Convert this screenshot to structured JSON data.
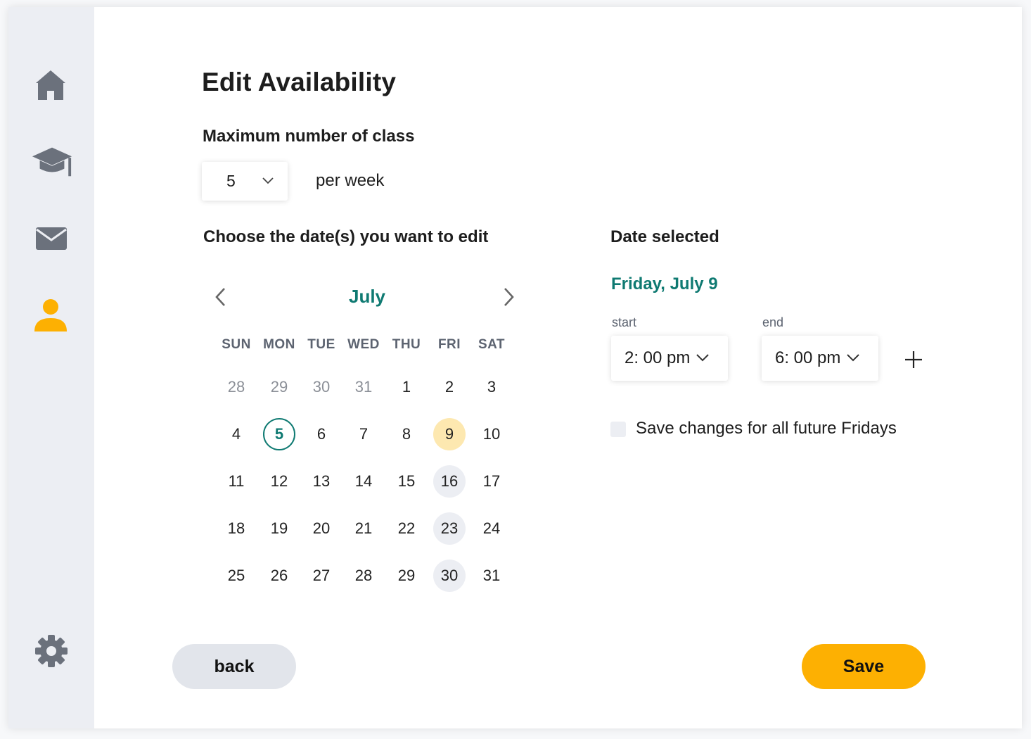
{
  "colors": {
    "accent": "#0f7a72",
    "primary_button": "#fdb002",
    "secondary_button": "#e2e5eb",
    "selected_day": "#fde8b0",
    "sidebar_bg": "#eceef3",
    "icon_gray": "#6b717c",
    "active_icon": "#fdb002"
  },
  "sidebar": {
    "items": [
      {
        "icon": "home-icon",
        "active": false
      },
      {
        "icon": "graduation-cap-icon",
        "active": false
      },
      {
        "icon": "mail-icon",
        "active": false
      },
      {
        "icon": "user-icon",
        "active": true
      }
    ],
    "settings_icon": "gear-icon"
  },
  "page": {
    "title": "Edit Availability",
    "max_label": "Maximum number of class",
    "max_value": "5",
    "per_week": "per week",
    "choose_label": "Choose the date(s) you want to edit",
    "selected_label": "Date selected"
  },
  "calendar": {
    "month": "July",
    "weekdays": [
      "SUN",
      "MON",
      "TUE",
      "WED",
      "THU",
      "FRI",
      "SAT"
    ],
    "weeks": [
      [
        {
          "d": "28",
          "muted": true
        },
        {
          "d": "29",
          "muted": true
        },
        {
          "d": "30",
          "muted": true
        },
        {
          "d": "31",
          "muted": true
        },
        {
          "d": "1"
        },
        {
          "d": "2"
        },
        {
          "d": "3"
        }
      ],
      [
        {
          "d": "4"
        },
        {
          "d": "5",
          "state": "today"
        },
        {
          "d": "6"
        },
        {
          "d": "7"
        },
        {
          "d": "8"
        },
        {
          "d": "9",
          "state": "selected"
        },
        {
          "d": "10"
        }
      ],
      [
        {
          "d": "11"
        },
        {
          "d": "12"
        },
        {
          "d": "13"
        },
        {
          "d": "14"
        },
        {
          "d": "15"
        },
        {
          "d": "16",
          "state": "same-weekday"
        },
        {
          "d": "17"
        }
      ],
      [
        {
          "d": "18"
        },
        {
          "d": "19"
        },
        {
          "d": "20"
        },
        {
          "d": "21"
        },
        {
          "d": "22"
        },
        {
          "d": "23",
          "state": "same-weekday"
        },
        {
          "d": "24"
        }
      ],
      [
        {
          "d": "25"
        },
        {
          "d": "26"
        },
        {
          "d": "27"
        },
        {
          "d": "28"
        },
        {
          "d": "29"
        },
        {
          "d": "30",
          "state": "same-weekday"
        },
        {
          "d": "31"
        }
      ]
    ]
  },
  "selection": {
    "date": "Friday, July 9",
    "start_label": "start",
    "start_value": "2: 00 pm",
    "end_label": "end",
    "end_value": "6: 00 pm",
    "repeat_label": "Save changes for all future Fridays",
    "repeat_checked": false
  },
  "actions": {
    "back_label": "back",
    "save_label": "Save"
  }
}
